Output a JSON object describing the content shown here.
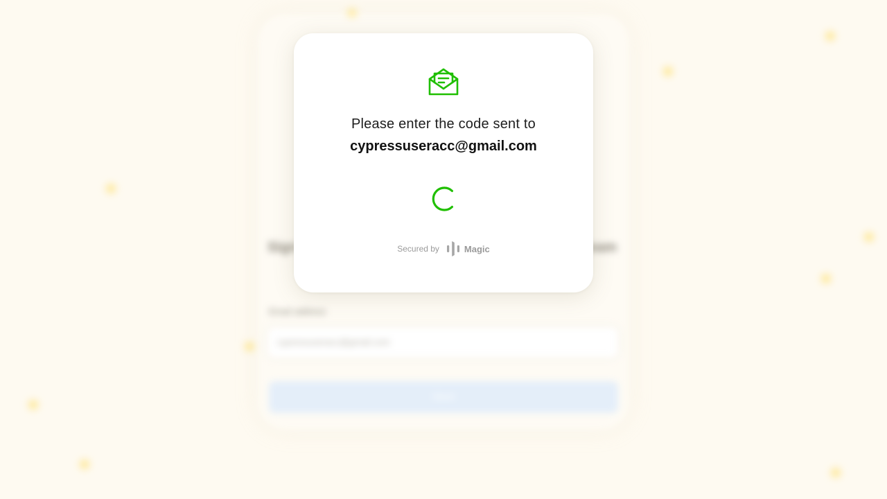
{
  "background": {
    "heading_left": "Sign",
    "heading_right": "eam",
    "field_label": "Email address",
    "input_value": "cypressuseracc@gmail.com",
    "button_label": "Next"
  },
  "modal": {
    "icon": "mail-open-icon",
    "prompt": "Please enter the code sent to",
    "email": "cypressuseracc@gmail.com",
    "status": "loading",
    "footer": {
      "secured_by": "Secured by",
      "brand_icon": "magic-logo-icon",
      "brand_name": "Magic"
    }
  },
  "colors": {
    "accent_green": "#1fbf00",
    "page_background": "#fefaf1",
    "card_background": "#ffffff",
    "muted_text": "#9a9a9a",
    "primary_text": "#111111"
  }
}
